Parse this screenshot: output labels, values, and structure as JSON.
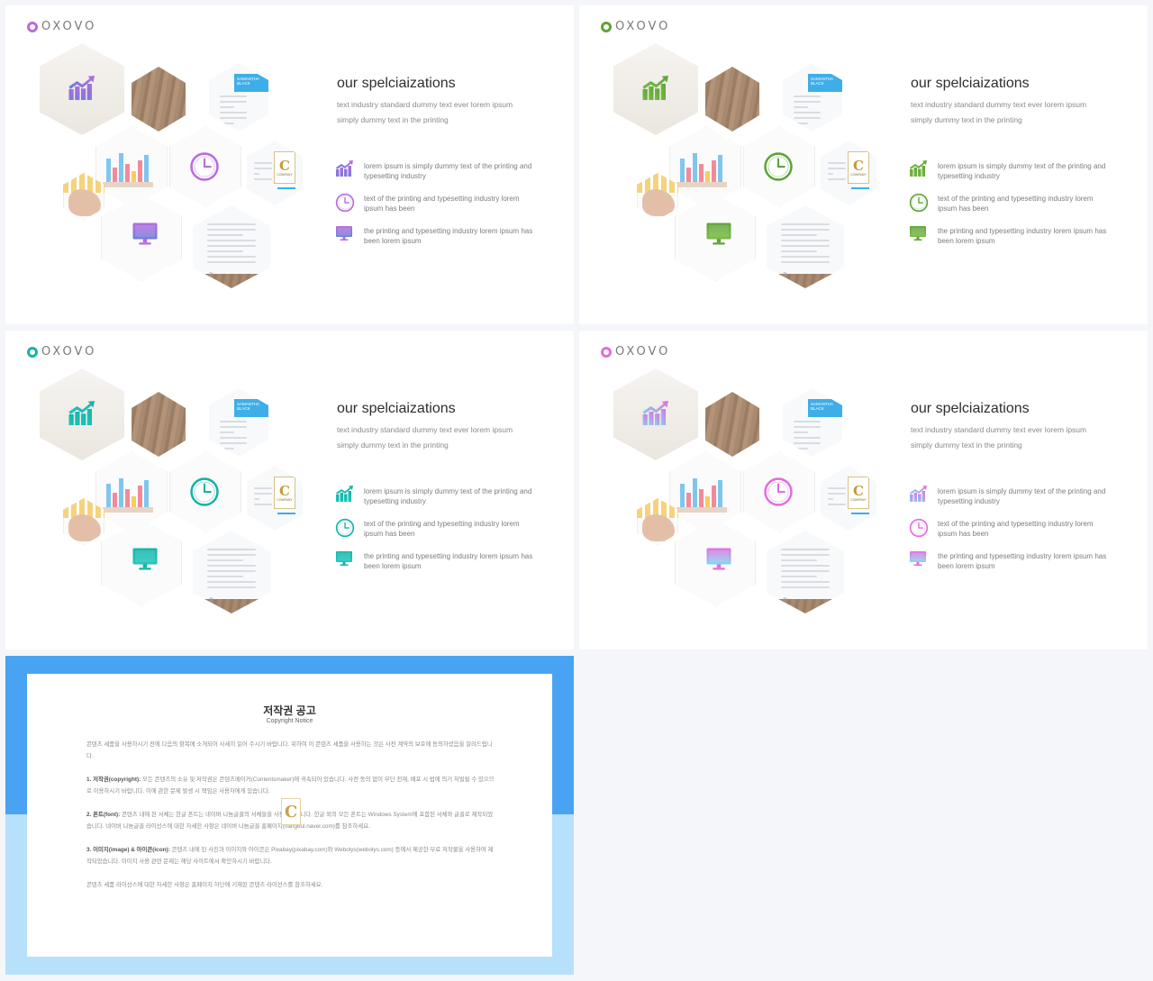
{
  "slides": [
    {
      "logo": "OXOVO",
      "accent": "#b86be0",
      "accent2": "#6c7fd8",
      "title": "our spelciaizations",
      "subtitle": "text industry standard dummy text ever lorem ipsum simply dummy text in the printing",
      "features": [
        {
          "icon": "growth-chart-icon",
          "text": "lorem ipsum is simply dummy text of the printing and typesetting industry"
        },
        {
          "icon": "clock-icon",
          "text": "text of the printing and typesetting industry lorem ipsum has been"
        },
        {
          "icon": "monitor-icon",
          "text": "the printing and typesetting industry lorem ipsum has been lorem ipsum"
        }
      ],
      "card_name": "SAMANTHA BLACK",
      "badge_letter": "C",
      "badge_text": "COMPANY"
    },
    {
      "logo": "OXOVO",
      "accent": "#5ea43a",
      "accent2": "#7cbb42",
      "title": "our spelciaizations",
      "subtitle": "text industry standard dummy text ever lorem ipsum simply dummy text in the printing",
      "features": [
        {
          "icon": "growth-chart-icon",
          "text": "lorem ipsum is simply dummy text of the printing and typesetting industry"
        },
        {
          "icon": "clock-icon",
          "text": "text of the printing and typesetting industry lorem ipsum has been"
        },
        {
          "icon": "monitor-icon",
          "text": "the printing and typesetting industry lorem ipsum has been lorem ipsum"
        }
      ],
      "card_name": "SAMANTHA BLACK",
      "badge_letter": "C",
      "badge_text": "COMPANY"
    },
    {
      "logo": "OXOVO",
      "accent": "#16b3a6",
      "accent2": "#1ec6c0",
      "title": "our spelciaizations",
      "subtitle": "text industry standard dummy text ever lorem ipsum simply dummy text in the printing",
      "features": [
        {
          "icon": "growth-chart-icon",
          "text": "lorem ipsum is simply dummy text of the printing and typesetting industry"
        },
        {
          "icon": "clock-icon",
          "text": "text of the printing and typesetting industry lorem ipsum has been"
        },
        {
          "icon": "monitor-icon",
          "text": "the printing and typesetting industry lorem ipsum has been lorem ipsum"
        }
      ],
      "card_name": "SAMANTHA BLACK",
      "badge_letter": "C",
      "badge_text": "COMPANY"
    },
    {
      "logo": "OXOVO",
      "accent": "#e36de0",
      "accent2": "#7fd8f2",
      "title": "our spelciaizations",
      "subtitle": "text industry standard dummy text ever lorem ipsum simply dummy text in the printing",
      "features": [
        {
          "icon": "growth-chart-icon",
          "text": "lorem ipsum is simply dummy text of the printing and typesetting industry"
        },
        {
          "icon": "clock-icon",
          "text": "text of the printing and typesetting industry lorem ipsum has been"
        },
        {
          "icon": "monitor-icon",
          "text": "the printing and typesetting industry lorem ipsum has been lorem ipsum"
        }
      ],
      "card_name": "SAMANTHA BLACK",
      "badge_letter": "C",
      "badge_text": "COMPANY"
    }
  ],
  "notice": {
    "title": "저작권 공고",
    "subtitle": "Copyright Notice",
    "paragraphs": [
      {
        "head": "",
        "text": "콘텐츠 세품을 사용하시기 전에 다음의 항목에 소개되어 사세히 읽어 주시기 바랍니다. 위하여 이 콘텐츠 세품을 사용하는 것은 사전 계약의 보호에 동의하셨음을 알려드립니다."
      },
      {
        "head": "1. 저작권(copyright):",
        "text": " 모든 콘텐츠의 소유 및 저작권은 콘텐츠메이커(Contentsmaker)에 귀속되어 있습니다. 사전 동의 없이 무단 전재, 배포 시 법에 의거 처벌될 수 있으므로 이용하시기 바랍니다. 이에 관한 문제 발생 시 책임은 사용자에게 있습니다."
      },
      {
        "head": "2. 폰트(font):",
        "text": " 콘텐츠 내에 된 서체는 한글 폰트는 네이버 나눔글꼴의 서체들을 사용하였습니다. 한글 외의 모든 폰트는 Windows System에 포함된 서체와 글꼴로 제작되었습니다. 네이버 나눔글꼴 라이선스에 대한 자세한 사항은 네이버 나눔글꼴 홈페이지(hangeul.naver.com)를 참조하세요."
      },
      {
        "head": "3. 이미지(image) & 아이콘(icon):",
        "text": " 콘텐츠 내에 된 사진과 이미지와 아이콘은 Pixabay(pixabay.com)와 Webolys(webolys.com) 등에서 제공한 무료 저작물을 사용하여 제작되었습니다. 이미지 사용 관련 문제는 해당 사이트에서 확인하시기 바랍니다."
      },
      {
        "head": "",
        "text": "콘텐츠 세품 라이선스에 대한 자세한 사항은 홈페이지 하단에 기재된 콘텐츠 라이선스를 참조하세요."
      }
    ],
    "watermark_letter": "C"
  }
}
